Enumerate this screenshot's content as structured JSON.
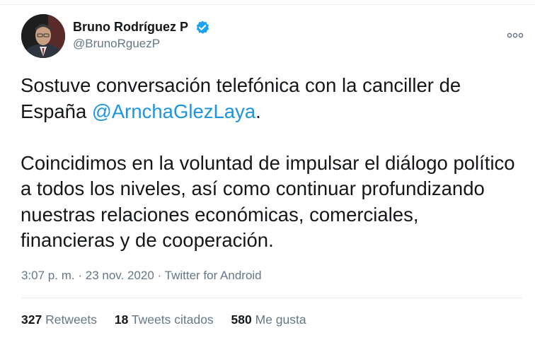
{
  "author": {
    "name": "Bruno Rodríguez P",
    "handle": "@BrunoRguezP",
    "verified": true
  },
  "tweet": {
    "line1": "Sostuve conversación telefónica con la canciller de",
    "line2_prefix": "España ",
    "mention": "@ArnchaGlezLaya",
    "line2_suffix": ".",
    "paragraph2": "Coincidimos en la voluntad de impulsar el diálogo político a todos los niveles, así como continuar profundizando nuestras relaciones económicas, comerciales, financieras y de cooperación."
  },
  "meta": {
    "time": "3:07 p. m.",
    "separator": "·",
    "date": "23 nov. 2020",
    "source": "Twitter for Android"
  },
  "stats": [
    {
      "count": "327",
      "label": "Retweets"
    },
    {
      "count": "18",
      "label": "Tweets citados"
    },
    {
      "count": "580",
      "label": "Me gusta"
    }
  ],
  "colors": {
    "link": "#1b95e0",
    "secondary": "#657786",
    "verified": "#1da1f2"
  }
}
